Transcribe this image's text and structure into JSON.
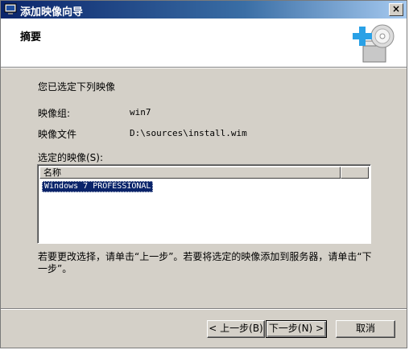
{
  "window": {
    "title": "添加映像向导",
    "close_glyph": "×"
  },
  "header": {
    "title": "摘要",
    "art_icon": "disc-add-icon"
  },
  "summary": {
    "intro": "您已选定下列映像",
    "image_group_label": "映像组:",
    "image_group_value": "win7",
    "image_file_label": "映像文件",
    "image_file_value": "D:\\sources\\install.wim"
  },
  "selected_images": {
    "label": "选定的映像(S):",
    "columns": [
      "名称",
      ""
    ],
    "items": [
      "Windows 7 PROFESSIONAL"
    ]
  },
  "note": "若要更改选择，请单击“上一步”。若要将选定的映像添加到服务器，请单击“下一步”。",
  "buttons": {
    "back": "< 上一步(B)",
    "next": "下一步(N) >",
    "cancel": "取消"
  },
  "colors": {
    "title_bar": "#0a246a",
    "selection": "#0a246a",
    "face": "#d4d0c8"
  }
}
